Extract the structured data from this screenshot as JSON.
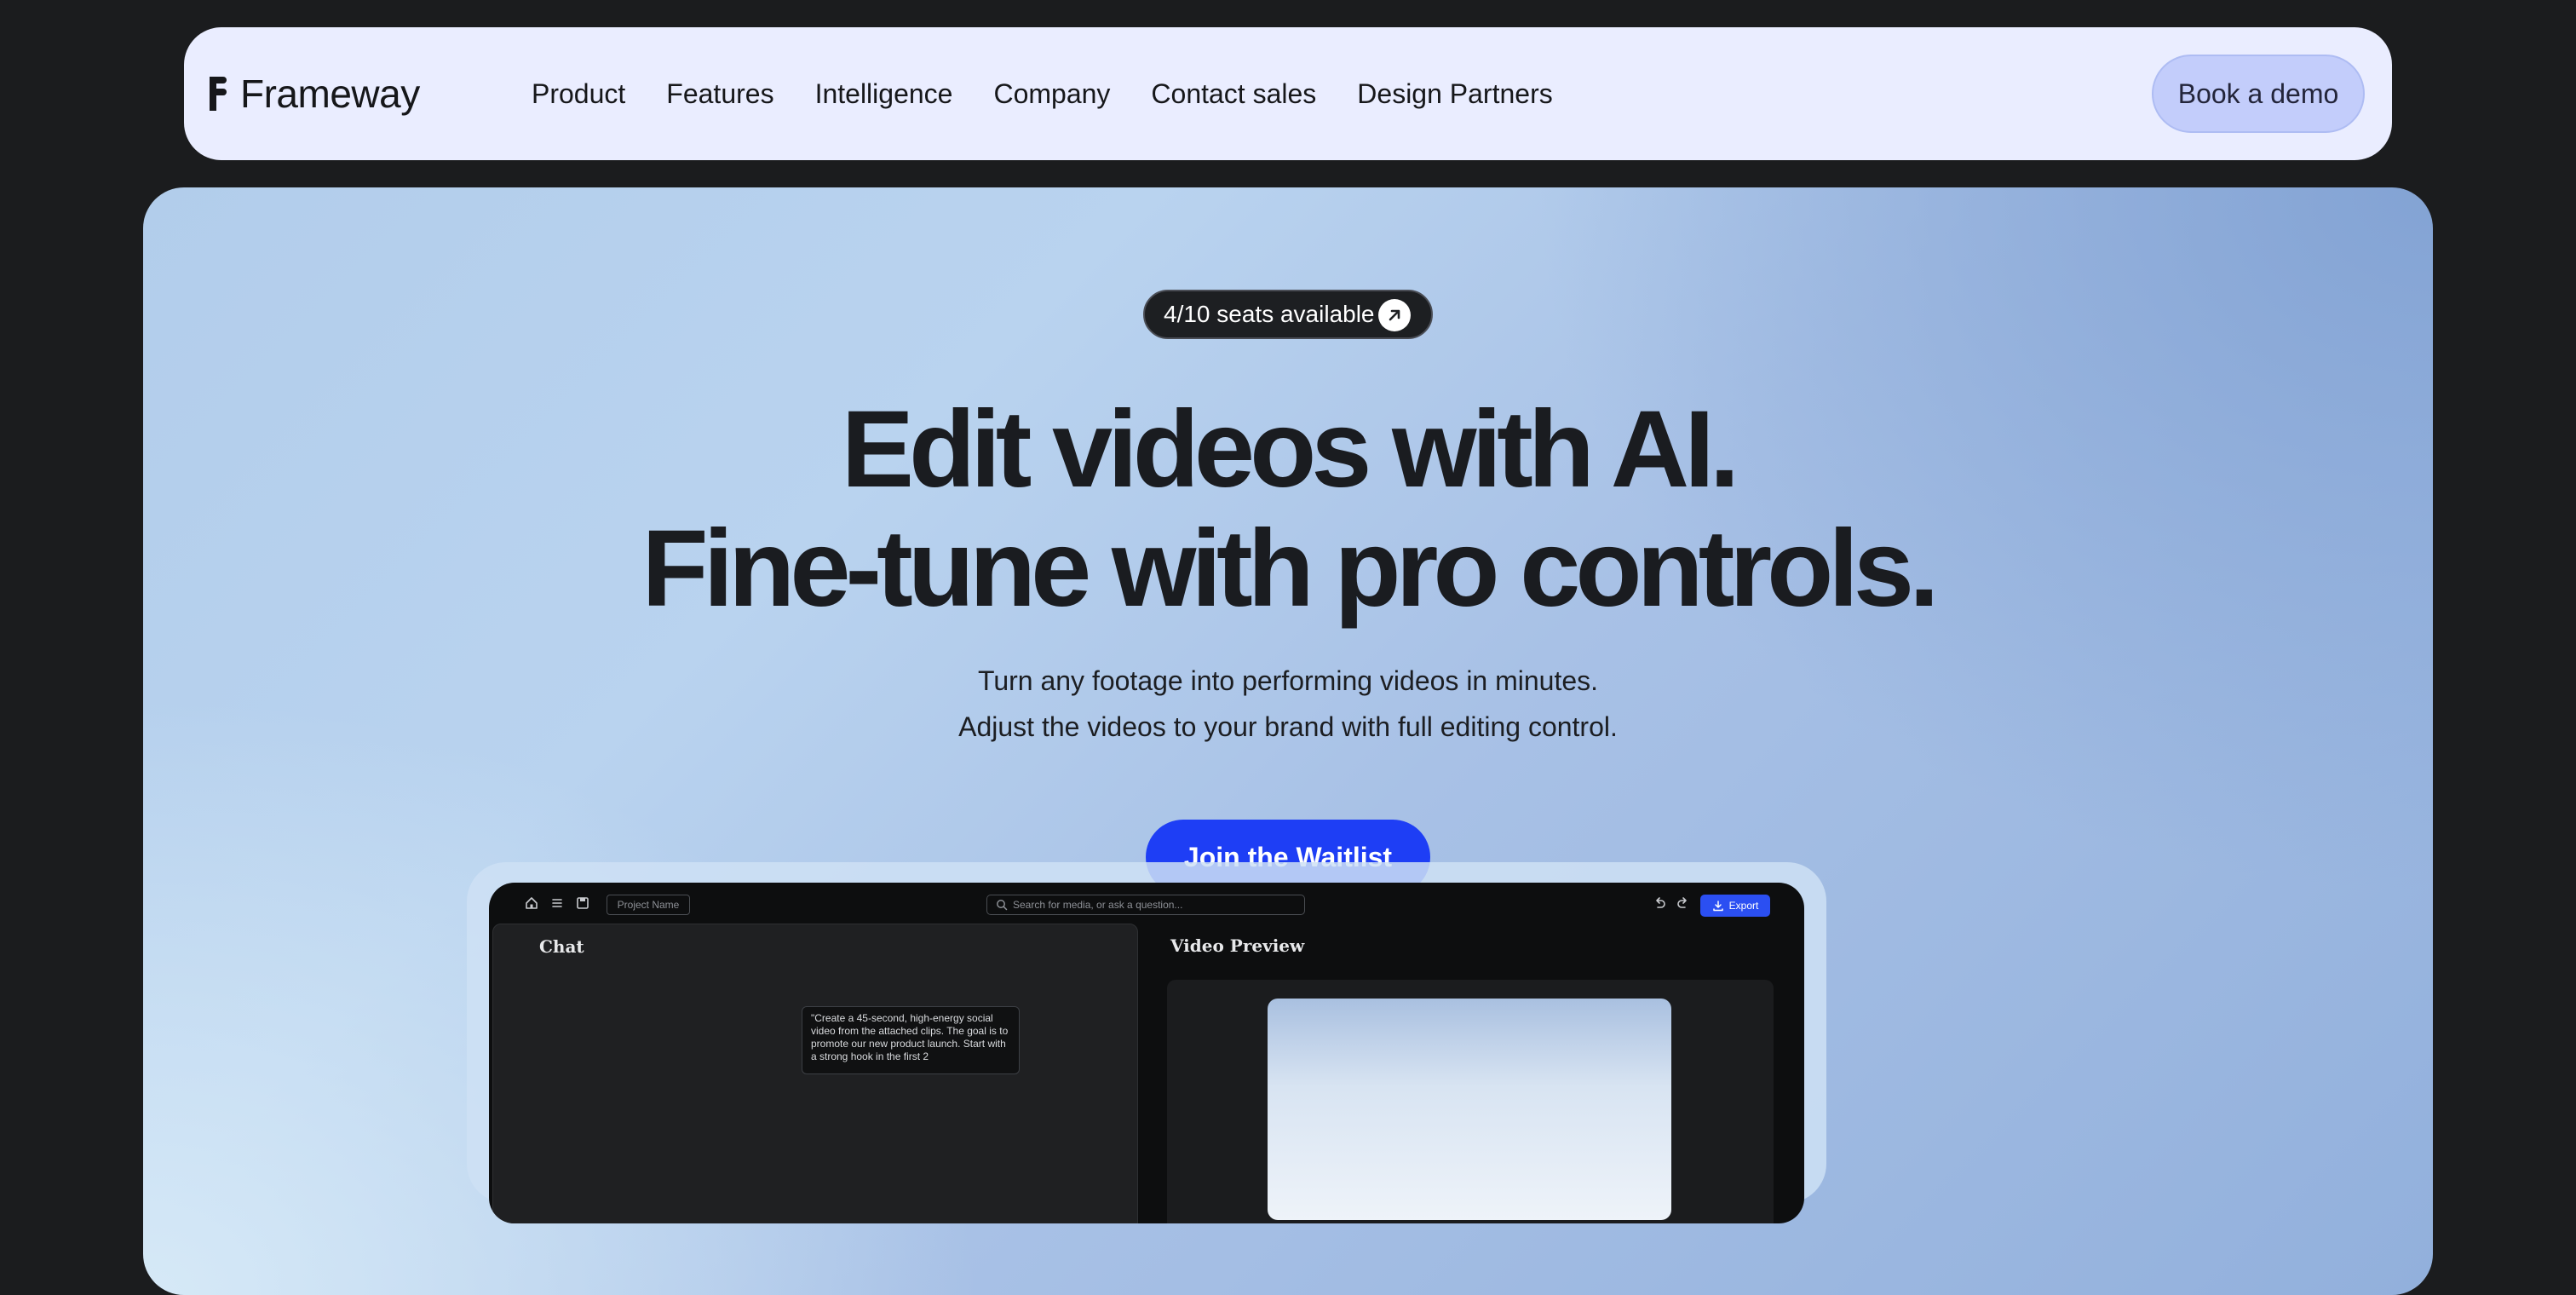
{
  "nav": {
    "logo_text": "Frameway",
    "links": [
      "Product",
      "Features",
      "Intelligence",
      "Company",
      "Contact sales",
      "Design Partners"
    ],
    "cta_label": "Book a demo"
  },
  "hero": {
    "badge_text": "4/10 seats available",
    "headline_line1": "Edit videos with AI.",
    "headline_line2": "Fine-tune with pro controls.",
    "subtitle_line1": "Turn any footage into performing videos in minutes.",
    "subtitle_line2": "Adjust the videos to your brand with full editing control.",
    "cta_label": "Join the Waitlist"
  },
  "app_preview": {
    "project_name_placeholder": "Project Name",
    "search_placeholder": "Search for media, or ask a question...",
    "export_label": "Export",
    "chat_title": "Chat",
    "chat_prompt": "\"Create a 45-second, high-energy social video from the attached clips. The goal is to promote our new product launch. Start with a strong hook in the first 2",
    "preview_title": "Video Preview"
  },
  "colors": {
    "accent": "#1e3ef5",
    "nav_bg": "#eaedff",
    "page_bg": "#1b1c1e"
  }
}
